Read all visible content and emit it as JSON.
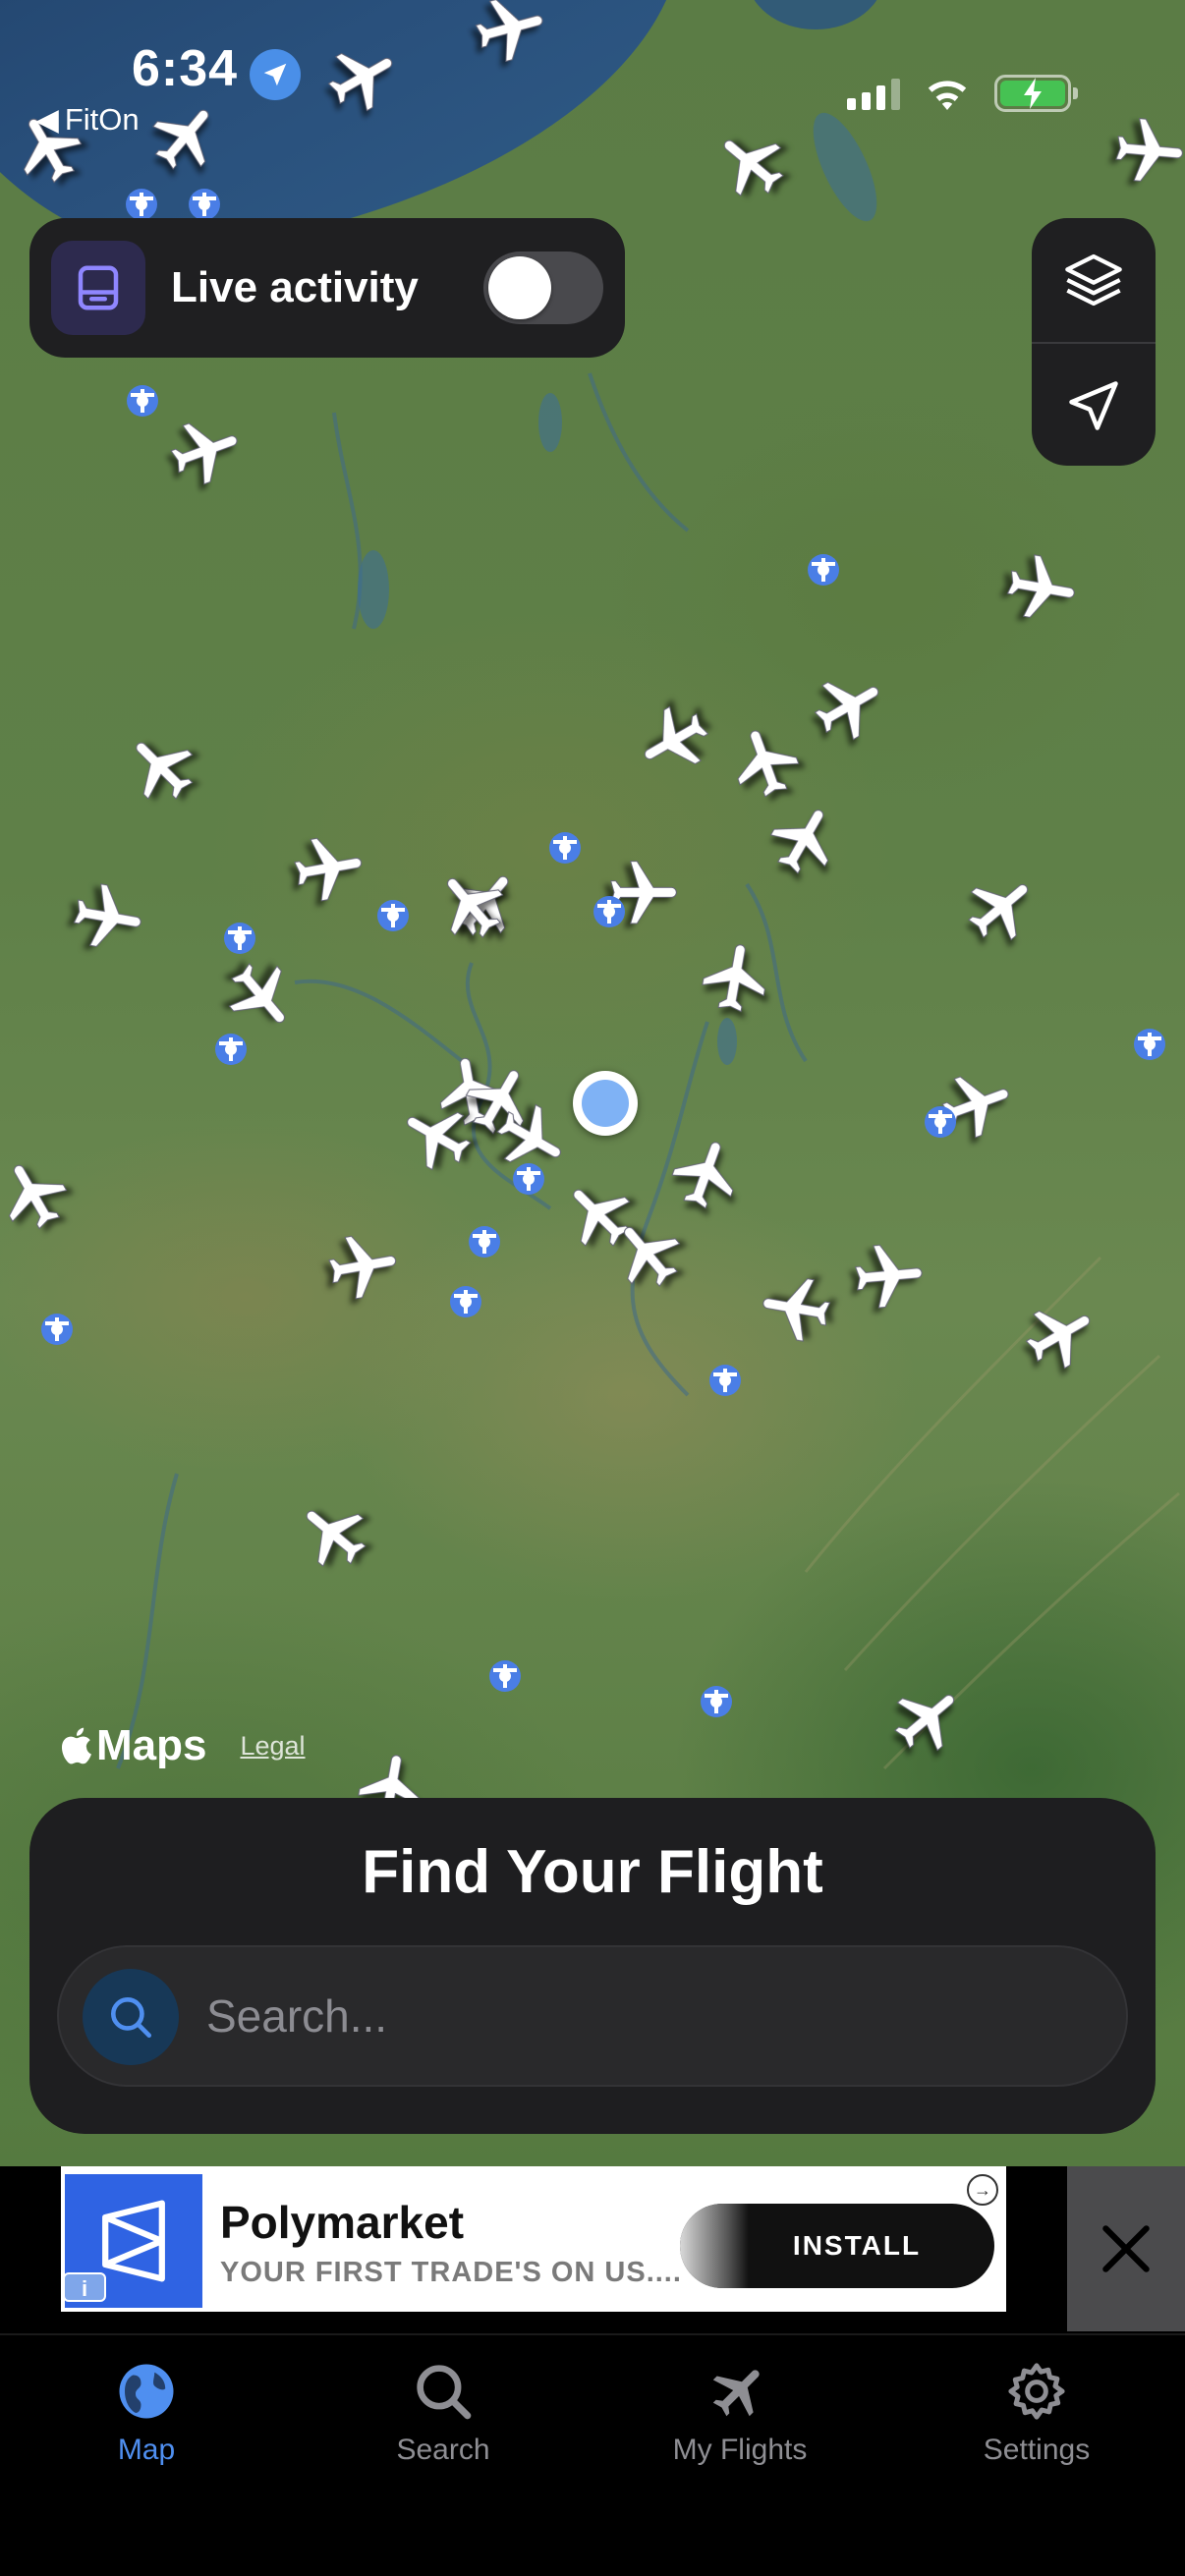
{
  "status_bar": {
    "time": "6:34",
    "back_app": "FitOn"
  },
  "live_activity": {
    "label": "Live activity",
    "enabled": false
  },
  "map": {
    "attribution_brand": "Maps",
    "legal_link": "Legal"
  },
  "find_flight": {
    "title": "Find Your Flight",
    "search_placeholder": "Search..."
  },
  "ad": {
    "name": "Polymarket",
    "tagline": "YOUR FIRST TRADE'S ON US....",
    "cta": "INSTALL",
    "info_badge": "i"
  },
  "tabs": [
    {
      "label": "Map",
      "icon": "globe-icon",
      "active": true
    },
    {
      "label": "Search",
      "icon": "search-icon",
      "active": false
    },
    {
      "label": "My Flights",
      "icon": "airplane-icon",
      "active": false
    },
    {
      "label": "Settings",
      "icon": "gear-icon",
      "active": false
    }
  ],
  "colors": {
    "accent_blue": "#4f8ff0",
    "panel_dark": "#1e1e20",
    "battery_green": "#46c253",
    "ad_brand_blue": "#2f63e3"
  }
}
